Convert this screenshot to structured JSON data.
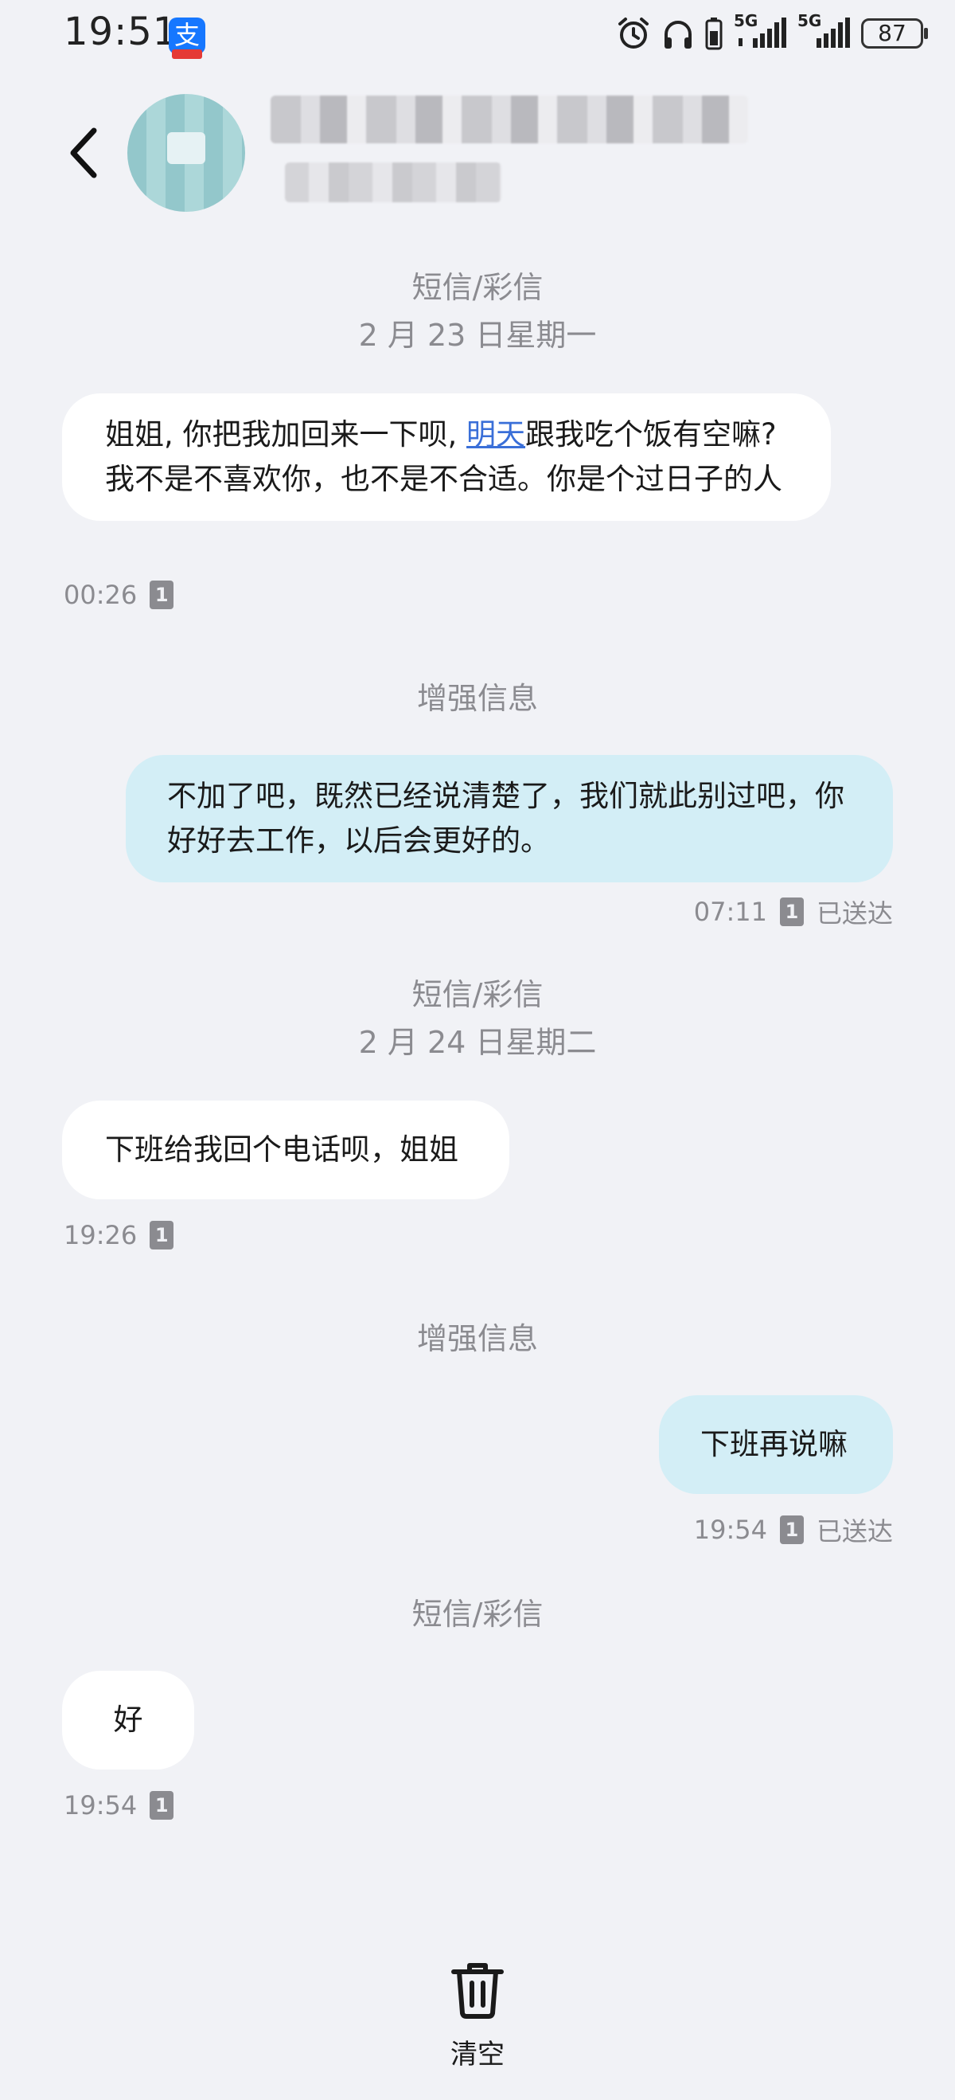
{
  "status_bar": {
    "time": "19:51",
    "app_badge": "支",
    "network_1": "5G",
    "network_2": "5G",
    "battery": "87"
  },
  "header": {
    "back_icon": "chevron-left-icon",
    "avatar": "blurred",
    "contact_name": "",
    "contact_number": ""
  },
  "conversation": {
    "label_1": "短信/彩信",
    "date_1": "2 月 23 日星期一",
    "msg_1_part_a": "姐姐, 你把我加回来一下呗, ",
    "msg_1_link": "明天",
    "msg_1_part_b": "跟我吃个饭有空嘛? 我不是不喜欢你，也不是不合适。你是个过日子的人",
    "msg_1_time": "00:26",
    "sim": "1",
    "label_2": "增强信息",
    "msg_2": "不加了吧，既然已经说清楚了，我们就此别过吧，你好好去工作，以后会更好的。",
    "msg_2_time": "07:11",
    "delivered": "已送达",
    "label_3": "短信/彩信",
    "date_2": "2 月 24 日星期二",
    "msg_3": "下班给我回个电话呗，姐姐",
    "msg_3_time": "19:26",
    "label_4": "增强信息",
    "msg_4": "下班再说嘛",
    "msg_4_time": "19:54",
    "label_5": "短信/彩信",
    "msg_5": "好",
    "msg_5_time": "19:54"
  },
  "footer": {
    "clear_icon": "trash-icon",
    "clear_label": "清空"
  },
  "colors": {
    "background": "#f1f2f6",
    "incoming_bubble": "#ffffff",
    "outgoing_bubble": "#d3eef6",
    "link": "#3a6fd8",
    "meta_text": "#8b8b90"
  }
}
